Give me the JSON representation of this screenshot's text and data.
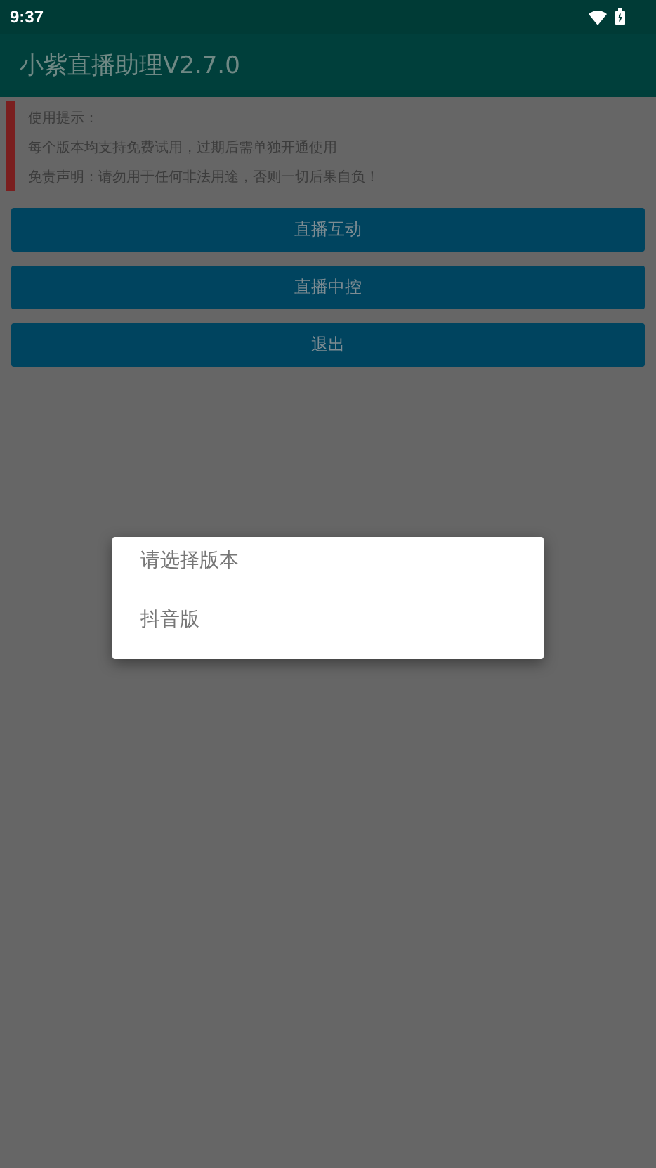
{
  "status_bar": {
    "time": "9:37"
  },
  "app_bar": {
    "title": "小紫直播助理V2.7.0"
  },
  "notice": {
    "lines": [
      "使用提示：",
      "每个版本均支持免费试用，过期后需单独开通使用",
      "免责声明：请勿用于任何非法用途，否则一切后果自负！"
    ]
  },
  "buttons": [
    "直播互动",
    "直播中控",
    "退出"
  ],
  "dialog": {
    "title": "请选择版本",
    "items": [
      "抖音版"
    ]
  }
}
